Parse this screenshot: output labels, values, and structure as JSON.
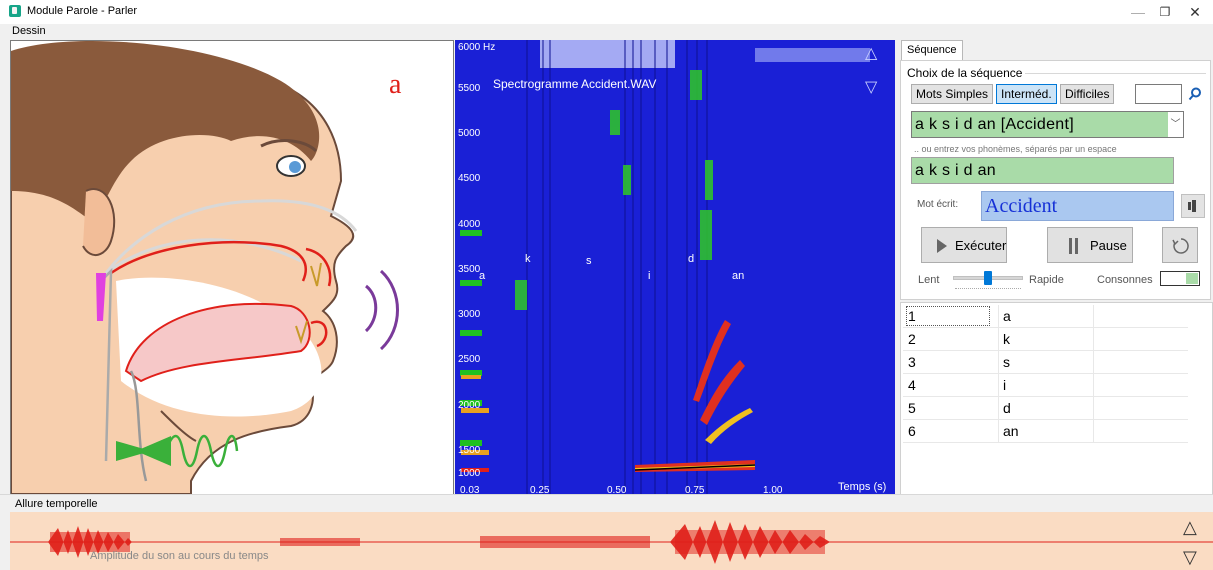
{
  "window": {
    "title": "Module Parole - Parler",
    "minimize": "—",
    "maximize": "❐",
    "close": "✕"
  },
  "menu": {
    "dessin": "Dessin"
  },
  "drawing": {
    "phoneme_letter": "a"
  },
  "spectrogram": {
    "title": "Spectrogramme Accident.WAV",
    "freq_top": "6000 Hz",
    "y_labels": [
      "5500",
      "5000",
      "4500",
      "4000",
      "3500",
      "3000",
      "2500",
      "2000",
      "1500",
      "1000"
    ],
    "x_labels": [
      "0.03",
      "0.25",
      "0.50",
      "0.75",
      "1.00"
    ],
    "phoneme_markers": [
      "a",
      "k",
      "s",
      "i",
      "d",
      "an"
    ],
    "time_label": "Temps (s)"
  },
  "sequence": {
    "tab": "Séquence",
    "group_label": "Choix de la séquence",
    "levels": [
      "Mots Simples",
      "Interméd.",
      "Difficiles"
    ],
    "selected_level": "Interméd.",
    "search_value": "",
    "combo_value": "a k s i d an [Accident]",
    "hint": ".. ou entrez vos phonèmes, séparés par un espace",
    "phonemes_input": "a k s i d an",
    "written_label": "Mot écrit:",
    "written_word": "Accident",
    "execute": "Exécuter",
    "pause": "Pause",
    "slow": "Lent",
    "fast": "Rapide",
    "speed": 0.5,
    "consonnes": "Consonnes"
  },
  "phoneme_table": [
    {
      "n": "1",
      "p": "a"
    },
    {
      "n": "2",
      "p": "k"
    },
    {
      "n": "3",
      "p": "s"
    },
    {
      "n": "4",
      "p": "i"
    },
    {
      "n": "5",
      "p": "d"
    },
    {
      "n": "6",
      "p": "an"
    }
  ],
  "waveform": {
    "section": "Allure temporelle",
    "caption": "Amplitude du son au cours du temps"
  },
  "colors": {
    "accent": "#0078d7",
    "spectro_bg": "#1a20d6",
    "input_green": "#a9dba8",
    "word_blue": "#aac8f0",
    "wave_bg": "#fadcc3",
    "wave_red": "#e0201a",
    "tongue": "#f6c8c8"
  }
}
